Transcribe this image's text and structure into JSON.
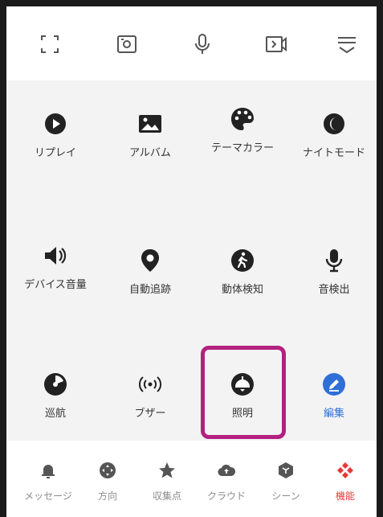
{
  "toolbar": {
    "icons": [
      "fullscreen-icon",
      "screenshot-icon",
      "microphone-icon",
      "record-video-icon",
      "menu-collapse-icon"
    ]
  },
  "grid": {
    "items": [
      {
        "label": "リプレイ",
        "icon": "play-circle-icon"
      },
      {
        "label": "アルバム",
        "icon": "image-icon"
      },
      {
        "label": "テーマカラー",
        "icon": "palette-icon"
      },
      {
        "label": "ナイトモード",
        "icon": "moon-icon"
      },
      {
        "label": "デバイス音量",
        "icon": "speaker-icon"
      },
      {
        "label": "自動追跡",
        "icon": "location-pin-icon"
      },
      {
        "label": "動体検知",
        "icon": "walking-person-icon"
      },
      {
        "label": "音検出",
        "icon": "microphone-icon"
      },
      {
        "label": "巡航",
        "icon": "cruise-icon"
      },
      {
        "label": "ブザー",
        "icon": "broadcast-icon"
      },
      {
        "label": "照明",
        "icon": "lamp-icon"
      },
      {
        "label": "編集",
        "icon": "edit-icon"
      }
    ]
  },
  "bottom_nav": {
    "items": [
      {
        "label": "メッセージ",
        "icon": "bell-icon"
      },
      {
        "label": "方向",
        "icon": "direction-pad-icon"
      },
      {
        "label": "収集点",
        "icon": "star-icon"
      },
      {
        "label": "クラウド",
        "icon": "cloud-upload-icon"
      },
      {
        "label": "シーン",
        "icon": "scene-cube-icon"
      },
      {
        "label": "機能",
        "icon": "function-diamond-icon"
      }
    ],
    "active": "機能"
  },
  "colors": {
    "panel_bg": "#f3f3f4",
    "icon_dark": "#222222",
    "highlight": "#b3217f",
    "accent_blue": "#2f6fd6",
    "active_red": "#e53935",
    "nav_gray": "#8c8c8c"
  }
}
